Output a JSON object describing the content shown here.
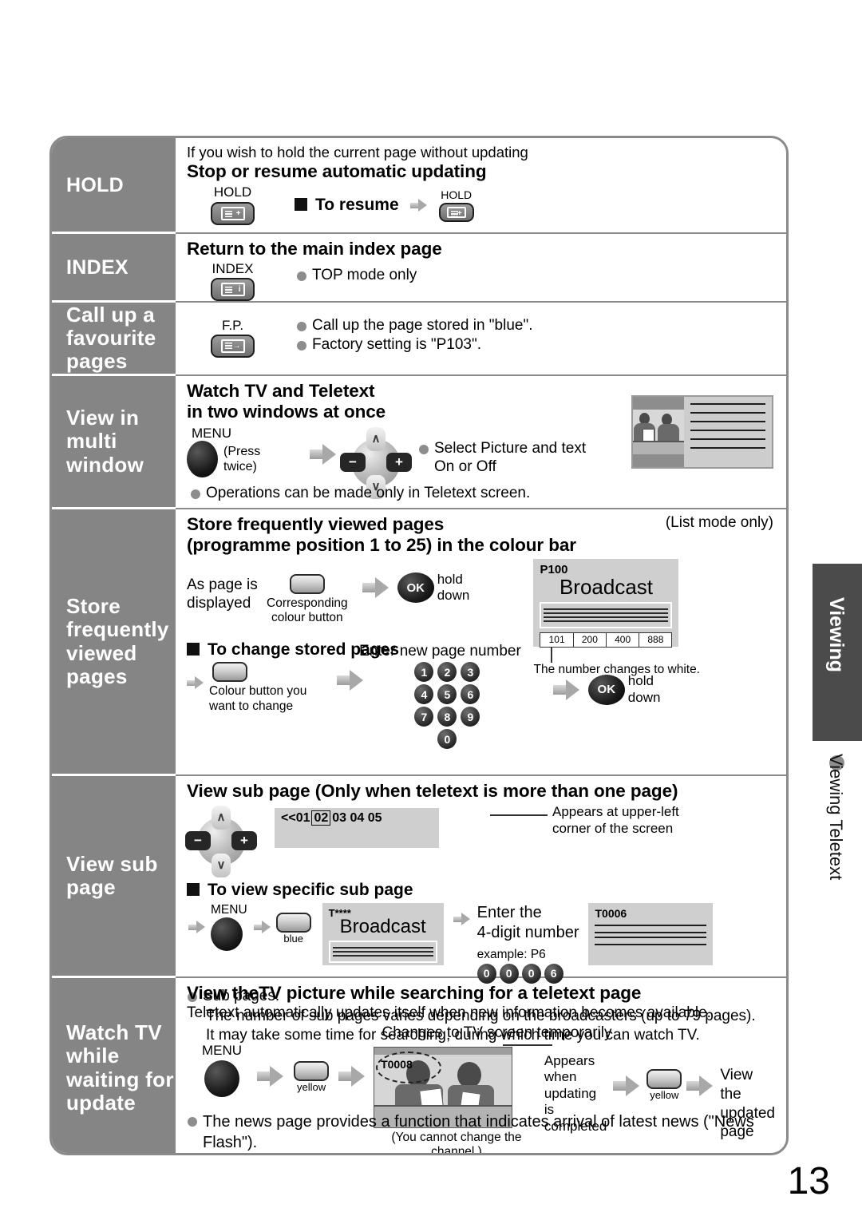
{
  "page": {
    "number": "13"
  },
  "side_tab": {
    "label": "Viewing",
    "chapter": "Viewing Teletext"
  },
  "sections": [
    {
      "id": "hold",
      "sidebar_label": "HOLD",
      "intro": "If you wish to hold the current page without updating",
      "heading": "Stop or resume automatic updating",
      "button_label": "HOLD",
      "resume_label": "To resume",
      "resume_button_label": "HOLD"
    },
    {
      "id": "index",
      "sidebar_label": "INDEX",
      "heading": "Return to the main index page",
      "button_label": "INDEX",
      "notes": [
        "TOP mode only"
      ]
    },
    {
      "id": "favourite",
      "sidebar_label": "Call up a favourite pages",
      "button_label": "F.P.",
      "notes": [
        "Call up the page stored in \"blue\".",
        "Factory setting is \"P103\"."
      ]
    },
    {
      "id": "multi-window",
      "sidebar_label": "View in multi window",
      "heading_line1": "Watch TV and Teletext",
      "heading_line2": "in two windows at once",
      "menu_label": "MENU",
      "press_twice": "(Press twice)",
      "select_line1": "Select Picture and text",
      "select_line2": "On or Off",
      "note": "Operations can be made only in Teletext screen."
    },
    {
      "id": "store",
      "sidebar_label": "Store frequently viewed pages",
      "heading_line1": "Store frequently viewed pages",
      "heading_line2": "(programme position 1 to 25) in the colour bar",
      "list_mode_only": "(List mode only)",
      "as_page_is": "As page is",
      "displayed": "displayed",
      "corresponding_line1": "Corresponding",
      "corresponding_line2": "colour button",
      "ok_label": "OK",
      "hold": "hold",
      "down": "down",
      "screen": {
        "page_id": "P100",
        "title": "Broadcast",
        "colour_bar": [
          "101",
          "200",
          "400",
          "888"
        ]
      },
      "white_note": "The number changes to white.",
      "change_heading": "To change stored pages",
      "enter_new_page": "Enter new page number",
      "colour_button_line1": "Colour button you",
      "colour_button_line2": "want to change",
      "keypad": [
        "1",
        "2",
        "3",
        "4",
        "5",
        "6",
        "7",
        "8",
        "9",
        "0"
      ],
      "ok_label2": "OK",
      "hold2": "hold",
      "down2": "down"
    },
    {
      "id": "subpage",
      "sidebar_label": "View sub page",
      "heading": "View sub page (Only when teletext is more than one page)",
      "subpage_indicator_prefix": "<<01",
      "subpage_selected": "02",
      "subpage_rest": "03 04 05",
      "appears_line1": "Appears at upper-left",
      "appears_line2": "corner of the screen",
      "specific_heading": "To view specific sub page",
      "menu_label": "MENU",
      "blue_label": "blue",
      "screen": {
        "page_id": "T****",
        "title": "Broadcast"
      },
      "enter_line1": "Enter the",
      "enter_line2": "4-digit number",
      "example": "example: P6",
      "example_keys": [
        "0",
        "0",
        "0",
        "6"
      ],
      "result_screen": {
        "page_id": "T0006"
      },
      "sub_pages_label": "Sub pages:",
      "sub_pages_line1": "The number of sub pages varies depending on the broadcasters (up to 79 pages).",
      "sub_pages_line2": "It may take some time for searching, during which time you can watch TV."
    },
    {
      "id": "watch-waiting",
      "sidebar_label": "Watch TV while waiting for update",
      "heading": "View theTV picture while searching for a teletext page",
      "intro": "Teletext automatically updates itself when new information becomes available.",
      "changes_note": "Changes to TV screen temporarily",
      "menu_label": "MENU",
      "yellow_label_1": "yellow",
      "tv_page_id": "T0008",
      "appears_lines": [
        "Appears",
        "when",
        "updating is",
        "completed"
      ],
      "yellow_label_2": "yellow",
      "view_updated_lines": [
        "View the",
        "updated",
        "page"
      ],
      "cannot_change": "(You cannot change the channel.)",
      "news_flash_note": "The news page provides a function that indicates arrival of latest news (\"News Flash\")."
    }
  ],
  "colors": {
    "sidebar": "#858585",
    "tab": "#4b4b4b",
    "screen": "#cfcfcf"
  }
}
